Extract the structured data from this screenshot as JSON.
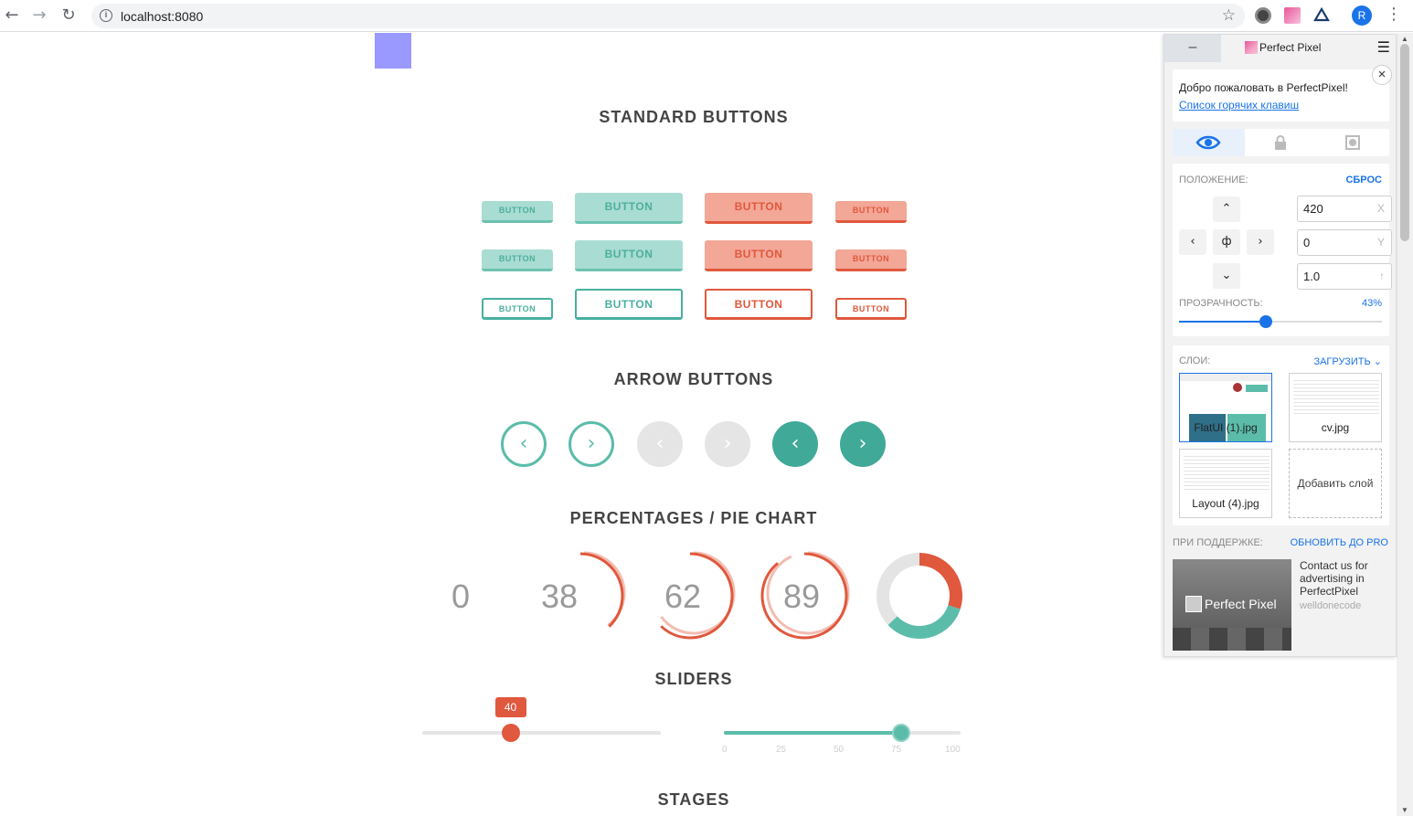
{
  "browser": {
    "url": "localhost:8080",
    "avatar_letter": "R",
    "back_icon": "←",
    "forward_icon": "→",
    "reload_icon": "↻",
    "star_icon": "☆",
    "menu_icon": "⋮"
  },
  "page": {
    "sections": {
      "standard_buttons": "STANDARD BUTTONS",
      "arrow_buttons": "ARROW BUTTONS",
      "percentages": "PERCENTAGES / PIE CHART",
      "sliders": "SLIDERS",
      "stages": "STAGES"
    },
    "button_label": "BUTTON",
    "arrows": {
      "left": "‹",
      "right": "›"
    },
    "percentages": [
      {
        "value": "0",
        "fraction": 0.0
      },
      {
        "value": "38",
        "fraction": 0.38
      },
      {
        "value": "62",
        "fraction": 0.62
      },
      {
        "value": "89",
        "fraction": 0.89
      }
    ],
    "pie": {
      "segments": [
        {
          "name": "red",
          "fraction": 0.3,
          "color": "#e0583d"
        },
        {
          "name": "teal",
          "fraction": 0.33,
          "color": "#5bbcaa"
        },
        {
          "name": "grey",
          "fraction": 0.37,
          "color": "#e4e4e4"
        }
      ]
    },
    "slider_red": {
      "value": "40",
      "fraction": 0.37,
      "color": "#e0583d"
    },
    "slider_teal": {
      "fraction": 0.75,
      "ticks": [
        "0",
        "25",
        "50",
        "75",
        "100"
      ],
      "color": "#5bbcaa"
    },
    "colors": {
      "teal": "#5bbcaa",
      "red": "#e0583d",
      "marker": "#9999ff"
    }
  },
  "perfect_pixel": {
    "title": "Perfect Pixel",
    "minimize": "–",
    "welcome_text": "Добро пожаловать в PerfectPixel!",
    "hotkeys_link": "Список горячих клавиш",
    "close_icon": "×",
    "position_label": "ПОЛОЖЕНИЕ:",
    "reset_link": "СБРОС",
    "x_value": "420",
    "x_suffix": "X",
    "y_value": "0",
    "y_suffix": "Y",
    "scale_value": "1.0",
    "scale_suffix": "↑",
    "opacity_label": "ПРОЗРАЧНОСТЬ:",
    "opacity_value": "43%",
    "opacity_fraction": 0.43,
    "layers_label": "СЛОИ:",
    "upload_link": "ЗАГРУЗИТЬ",
    "layers": [
      {
        "name": "FlatUI (1).jpg",
        "selected": true
      },
      {
        "name": "cv.jpg",
        "selected": false
      },
      {
        "name": "Layout (4).jpg",
        "selected": false
      }
    ],
    "add_layer": "Добавить слой",
    "support_label": "ПРИ ПОДДЕРЖКЕ:",
    "upgrade_link": "ОБНОВИТЬ ДО PRO",
    "ad_brand": "Perfect Pixel",
    "ad_text": "Contact us for advertising in PerfectPixel",
    "ad_author": "welldonecode",
    "nav": {
      "up": "⌃",
      "down": "⌄",
      "left": "‹",
      "right": "›",
      "center": "ф"
    }
  }
}
